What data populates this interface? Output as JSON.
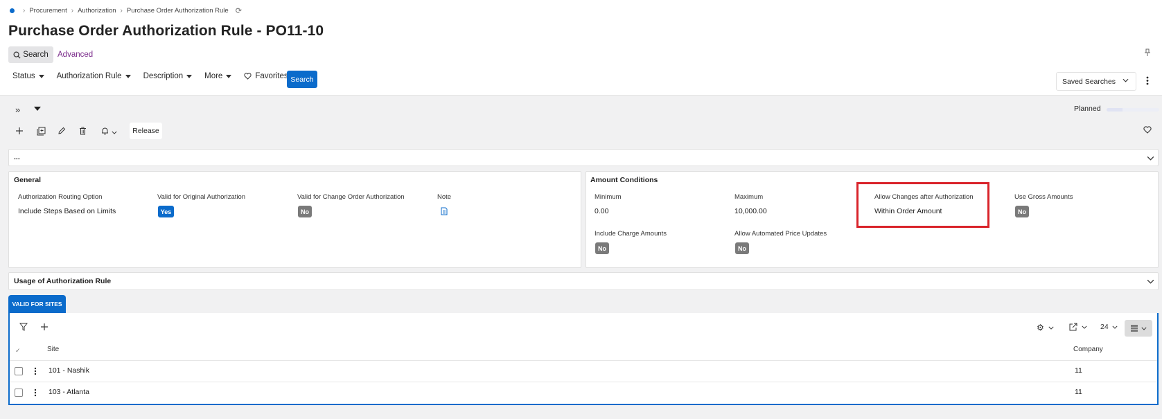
{
  "breadcrumb": {
    "items": [
      "Procurement",
      "Authorization",
      "Purchase Order Authorization Rule"
    ]
  },
  "page": {
    "title": "Purchase Order Authorization Rule - PO11-10"
  },
  "search": {
    "button_label": "Search",
    "advanced_label": "Advanced"
  },
  "filters": {
    "items": [
      "Status",
      "Authorization Rule",
      "Description",
      "More"
    ],
    "favorites_label": "Favorites",
    "search_button": "Search",
    "saved_searches": "Saved Searches"
  },
  "toolbar": {
    "release_label": "Release",
    "planned_label": "Planned",
    "planned_progress": 0.3
  },
  "summary_panel": {
    "label": "..."
  },
  "general": {
    "title": "General",
    "fields": [
      {
        "label": "Authorization Routing Option",
        "value": "Include Steps Based on Limits"
      },
      {
        "label": "Valid for Original Authorization",
        "value": "Yes"
      },
      {
        "label": "Valid for Change Order Authorization",
        "value": "No"
      },
      {
        "label": "Note",
        "value": ""
      }
    ]
  },
  "amount": {
    "title": "Amount Conditions",
    "fields": [
      {
        "label": "Minimum",
        "value": "0.00"
      },
      {
        "label": "Maximum",
        "value": "10,000.00"
      },
      {
        "label": "Allow Changes after Authorization",
        "value": "Within Order Amount"
      },
      {
        "label": "Use Gross Amounts",
        "value": "No"
      },
      {
        "label": "Include Charge Amounts",
        "value": "No"
      },
      {
        "label": "Allow Automated Price Updates",
        "value": "No"
      }
    ]
  },
  "usage": {
    "title": "Usage of Authorization Rule"
  },
  "tab": {
    "label": "VALID FOR SITES"
  },
  "grid": {
    "page_size": "24",
    "columns": [
      "Site",
      "Company"
    ],
    "rows": [
      {
        "site": "101 - Nashik",
        "company": "11"
      },
      {
        "site": "103 - Atlanta",
        "company": "11"
      }
    ]
  },
  "colors": {
    "accent": "#0b6bcb",
    "highlight": "#d9232a",
    "badge_no": "#7a7a7a"
  }
}
